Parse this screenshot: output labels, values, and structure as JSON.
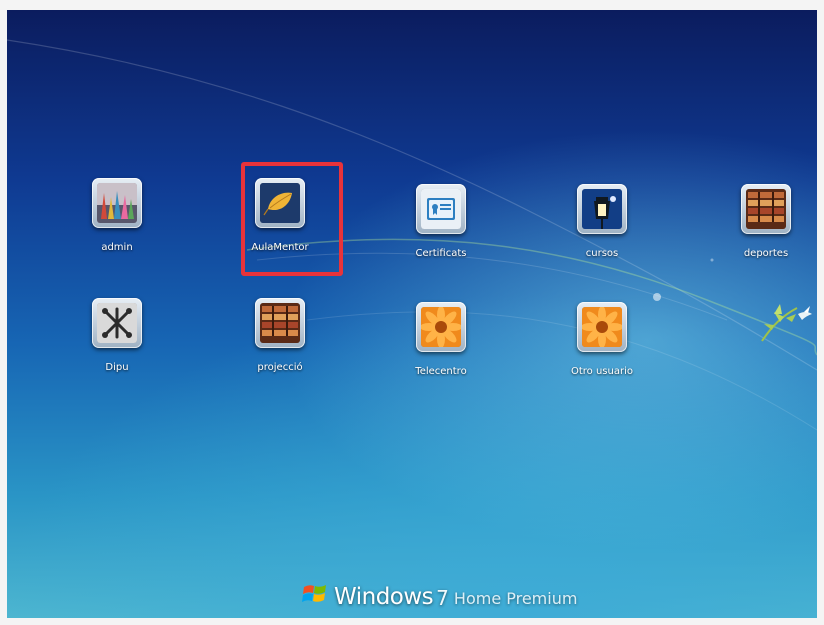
{
  "login_screen": {
    "users": [
      {
        "name": "admin",
        "picture": "chess-pieces-picture"
      },
      {
        "name": "AulaMentor",
        "picture": "leaf-picture"
      },
      {
        "name": "Certificats",
        "picture": "certificate-picture"
      },
      {
        "name": "cursos",
        "picture": "lantern-picture"
      },
      {
        "name": "deportes",
        "picture": "books-picture"
      },
      {
        "name": "Dipu",
        "picture": "jacks-picture"
      },
      {
        "name": "projecció",
        "picture": "books-picture"
      },
      {
        "name": "Telecentro",
        "picture": "orange-flower-picture"
      },
      {
        "name": "Otro usuario",
        "picture": "orange-flower-picture"
      }
    ],
    "highlighted_user": "AulaMentor",
    "highlight_color": "#e8333a"
  },
  "branding": {
    "brand": "Windows",
    "version": "7",
    "edition": "Home Premium"
  }
}
